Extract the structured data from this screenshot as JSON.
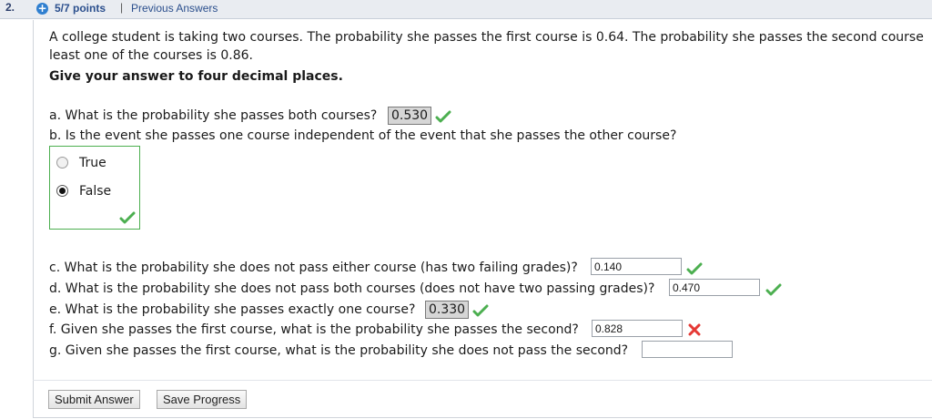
{
  "header": {
    "question_number": "2.",
    "points": "5/7 points",
    "separator": "|",
    "previous_answers": "Previous Answers"
  },
  "question": {
    "line1": "A college student is taking two courses. The probability she passes the first course is 0.64. The probability she passes the second course",
    "line2": "least one of the courses is 0.86.",
    "instruction": "Give your answer to four decimal places."
  },
  "parts": {
    "a": {
      "text": "a. What is the probability she passes both courses?",
      "answer": "0.530",
      "status": "correct"
    },
    "b": {
      "text": "b. Is the event she passes one course independent of the event that she passes the other course?",
      "options": [
        "True",
        "False"
      ],
      "selected": "False",
      "status": "correct"
    },
    "c": {
      "text": "c. What is the probability she does not pass either course (has two failing grades)?",
      "answer": "0.140",
      "status": "correct"
    },
    "d": {
      "text": "d. What is the probability she does not pass both courses (does not have two passing grades)?",
      "answer": "0.470",
      "status": "correct"
    },
    "e": {
      "text": "e. What is the probability she passes exactly one course?",
      "answer": "0.330",
      "status": "correct"
    },
    "f": {
      "text": "f. Given she passes the first course, what is the probability she passes the second?",
      "answer": "0.828",
      "status": "incorrect"
    },
    "g": {
      "text": "g. Given she passes the first course, what is the probability she does not pass the second?",
      "answer": "",
      "status": "unanswered"
    }
  },
  "buttons": {
    "submit": "Submit Answer",
    "save": "Save Progress"
  },
  "colors": {
    "correct": "#4caf50",
    "incorrect": "#e53935",
    "header_bg": "#e9ecf1",
    "link": "#2b4f8d"
  }
}
